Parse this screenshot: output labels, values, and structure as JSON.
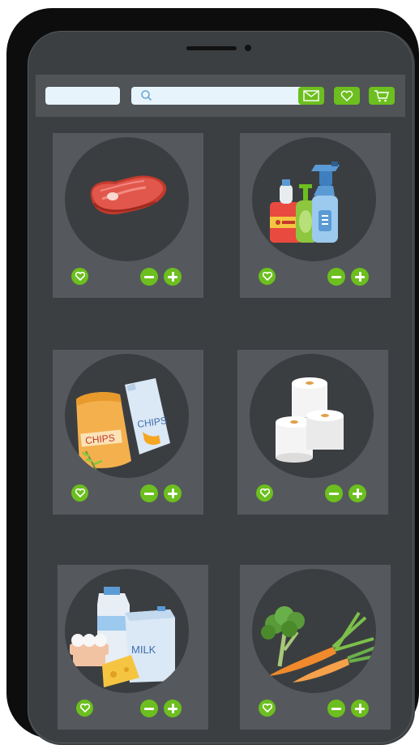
{
  "search": {
    "placeholder": ""
  },
  "toolbar": {
    "icons": [
      "mail-icon",
      "heart-icon",
      "cart-icon"
    ],
    "accent": "#6cbf1e"
  },
  "products": [
    {
      "name": "meat",
      "label": ""
    },
    {
      "name": "cleaning-supplies",
      "label": ""
    },
    {
      "name": "chips",
      "label": "CHIPS",
      "label2": "CHIPS"
    },
    {
      "name": "toilet-paper",
      "label": ""
    },
    {
      "name": "dairy",
      "label": "MILK"
    },
    {
      "name": "vegetables",
      "label": ""
    }
  ],
  "colors": {
    "screen": "#3c3f42",
    "card": "#55595d",
    "accent": "#6cbf1e",
    "field": "#e8f4fb"
  }
}
